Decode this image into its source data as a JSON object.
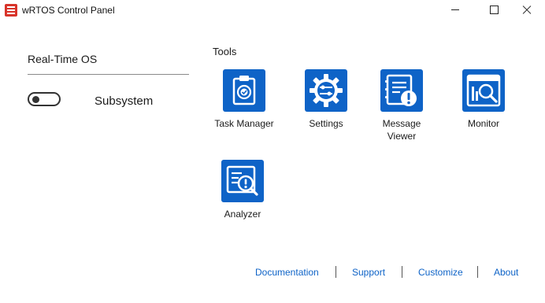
{
  "window": {
    "title": "wRTOS Control Panel",
    "icon": "control-panel-app-icon",
    "buttons": [
      "minimize",
      "maximize",
      "close"
    ]
  },
  "left_panel": {
    "title": "Real-Time OS",
    "toggle": {
      "label": "Subsystem",
      "state": "off"
    }
  },
  "tools": {
    "heading": "Tools",
    "items": [
      {
        "label": "Task Manager",
        "icon": "task-manager-icon"
      },
      {
        "label": "Settings",
        "icon": "settings-gear-icon"
      },
      {
        "label_line1": "Message",
        "label_line2": "Viewer",
        "icon": "message-viewer-icon"
      },
      {
        "label": "Monitor",
        "icon": "monitor-icon"
      },
      {
        "label": "Analyzer",
        "icon": "analyzer-icon"
      }
    ]
  },
  "footer": {
    "links": [
      "Documentation",
      "Support",
      "Customize",
      "About"
    ]
  },
  "colors": {
    "accent": "#0e63c7",
    "app_icon": "#d8342a",
    "background": "#ffffff"
  }
}
